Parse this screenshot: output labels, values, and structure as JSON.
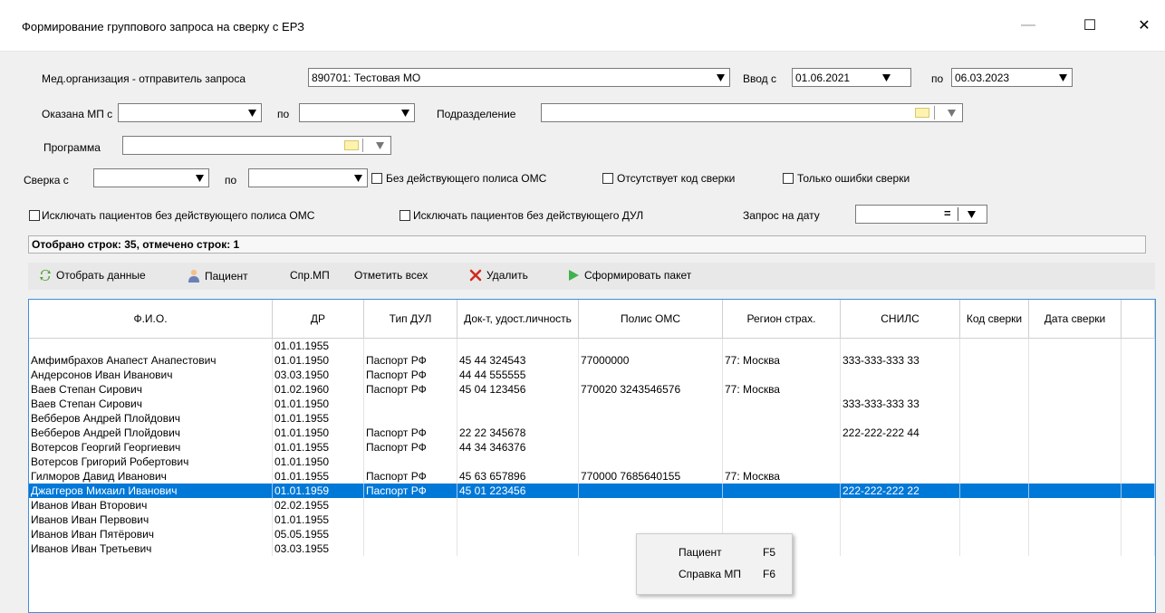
{
  "window": {
    "title": "Формирование группового запроса на сверку с ЕРЗ",
    "minimize": "—",
    "maximize": "☐",
    "close": "✕"
  },
  "filters": {
    "sender_label": "Мед.организация - отправитель запроса",
    "sender_value": "890701: Тестовая МО",
    "input_from_label": "Ввод с",
    "input_from": "01.06.2021",
    "input_to_label": "по",
    "input_to": "06.03.2023",
    "mp_from_label": "Оказана МП с",
    "mp_from": "",
    "mp_to_label": "по",
    "mp_to": "",
    "department_label": "Подразделение",
    "department": "",
    "program_label": "Программа",
    "program": "",
    "recon_from_label": "Сверка с",
    "recon_from": "",
    "recon_to_label": "по",
    "recon_to": "",
    "no_policy_label": "Без действующего полиса ОМС",
    "no_code_label": "Отсутствует код сверки",
    "only_errors_label": "Только ошибки сверки",
    "excl_policy_label": "Исключать пациентов без действующего полиса ОМС",
    "excl_dul_label": "Исключать пациентов без действующего ДУЛ",
    "request_date_label": "Запрос на дату",
    "request_date": "",
    "request_date_op": "="
  },
  "status_text": "Отобрано строк: 35, отмечено строк: 1",
  "toolbar": {
    "select_data": "Отобрать данные",
    "patient": "Пациент",
    "spr_mp": "Спр.МП",
    "mark_all": "Отметить всех",
    "delete": "Удалить",
    "form_package": "Сформировать пакет"
  },
  "table": {
    "columns": [
      "Ф.И.О.",
      "ДР",
      "Тип ДУЛ",
      "Док-т, удост.личность",
      "Полис ОМС",
      "Регион страх.",
      "СНИЛС",
      "Код сверки",
      "Дата сверки"
    ],
    "rows": [
      [
        "",
        "01.01.1955",
        "",
        "",
        "",
        "",
        "",
        "",
        ""
      ],
      [
        "Амфимбрахов Анапест Анапестович",
        "01.01.1950",
        "Паспорт РФ",
        "45 44 324543",
        "77000000",
        "77: Москва",
        "333-333-333 33",
        "",
        ""
      ],
      [
        "Андерсонов Иван Иванович",
        "03.03.1950",
        "Паспорт РФ",
        "44 44 555555",
        "",
        "",
        "",
        "",
        ""
      ],
      [
        "Ваев Степан Сирович",
        "01.02.1960",
        "Паспорт РФ",
        "45 04 123456",
        "770020 3243546576",
        "77: Москва",
        "",
        "",
        ""
      ],
      [
        "Ваев Степан Сирович",
        "01.01.1950",
        "",
        "",
        "",
        "",
        "333-333-333 33",
        "",
        ""
      ],
      [
        "Вебберов Андрей Плойдович",
        "01.01.1955",
        "",
        "",
        "",
        "",
        "",
        "",
        ""
      ],
      [
        "Вебберов Андрей Плойдович",
        "01.01.1950",
        "Паспорт РФ",
        "22 22 345678",
        "",
        "",
        "222-222-222 44",
        "",
        ""
      ],
      [
        "Вотерсов Георгий Георгиевич",
        "01.01.1955",
        "Паспорт РФ",
        "44 34 346376",
        "",
        "",
        "",
        "",
        ""
      ],
      [
        "Вотерсов Григорий Робертович",
        "01.01.1950",
        "",
        "",
        "",
        "",
        "",
        "",
        ""
      ],
      [
        "Гилморов Давид Иванович",
        "01.01.1955",
        "Паспорт РФ",
        "45 63 657896",
        "770000 7685640155",
        "77: Москва",
        "",
        "",
        ""
      ],
      [
        "Джаггеров Михаил Иванович",
        "01.01.1959",
        "Паспорт РФ",
        "45 01 223456",
        "",
        "",
        "222-222-222 22",
        "",
        ""
      ],
      [
        "Иванов Иван Вторович",
        "02.02.1955",
        "",
        "",
        "",
        "",
        "",
        "",
        ""
      ],
      [
        "Иванов Иван Первович",
        "01.01.1955",
        "",
        "",
        "",
        "",
        "",
        "",
        ""
      ],
      [
        "Иванов Иван Пятёрович",
        "05.05.1955",
        "",
        "",
        "",
        "",
        "",
        "",
        ""
      ],
      [
        "Иванов Иван Третьевич",
        "03.03.1955",
        "",
        "",
        "",
        "",
        "",
        "",
        ""
      ]
    ],
    "selected_row": 10
  },
  "context_menu": {
    "items": [
      {
        "label": "Пациент",
        "shortcut": "F5"
      },
      {
        "label": "Справка МП",
        "shortcut": "F6"
      }
    ]
  },
  "colors": {
    "selection": "#0078d7",
    "grid_border": "#3d8ee0"
  }
}
